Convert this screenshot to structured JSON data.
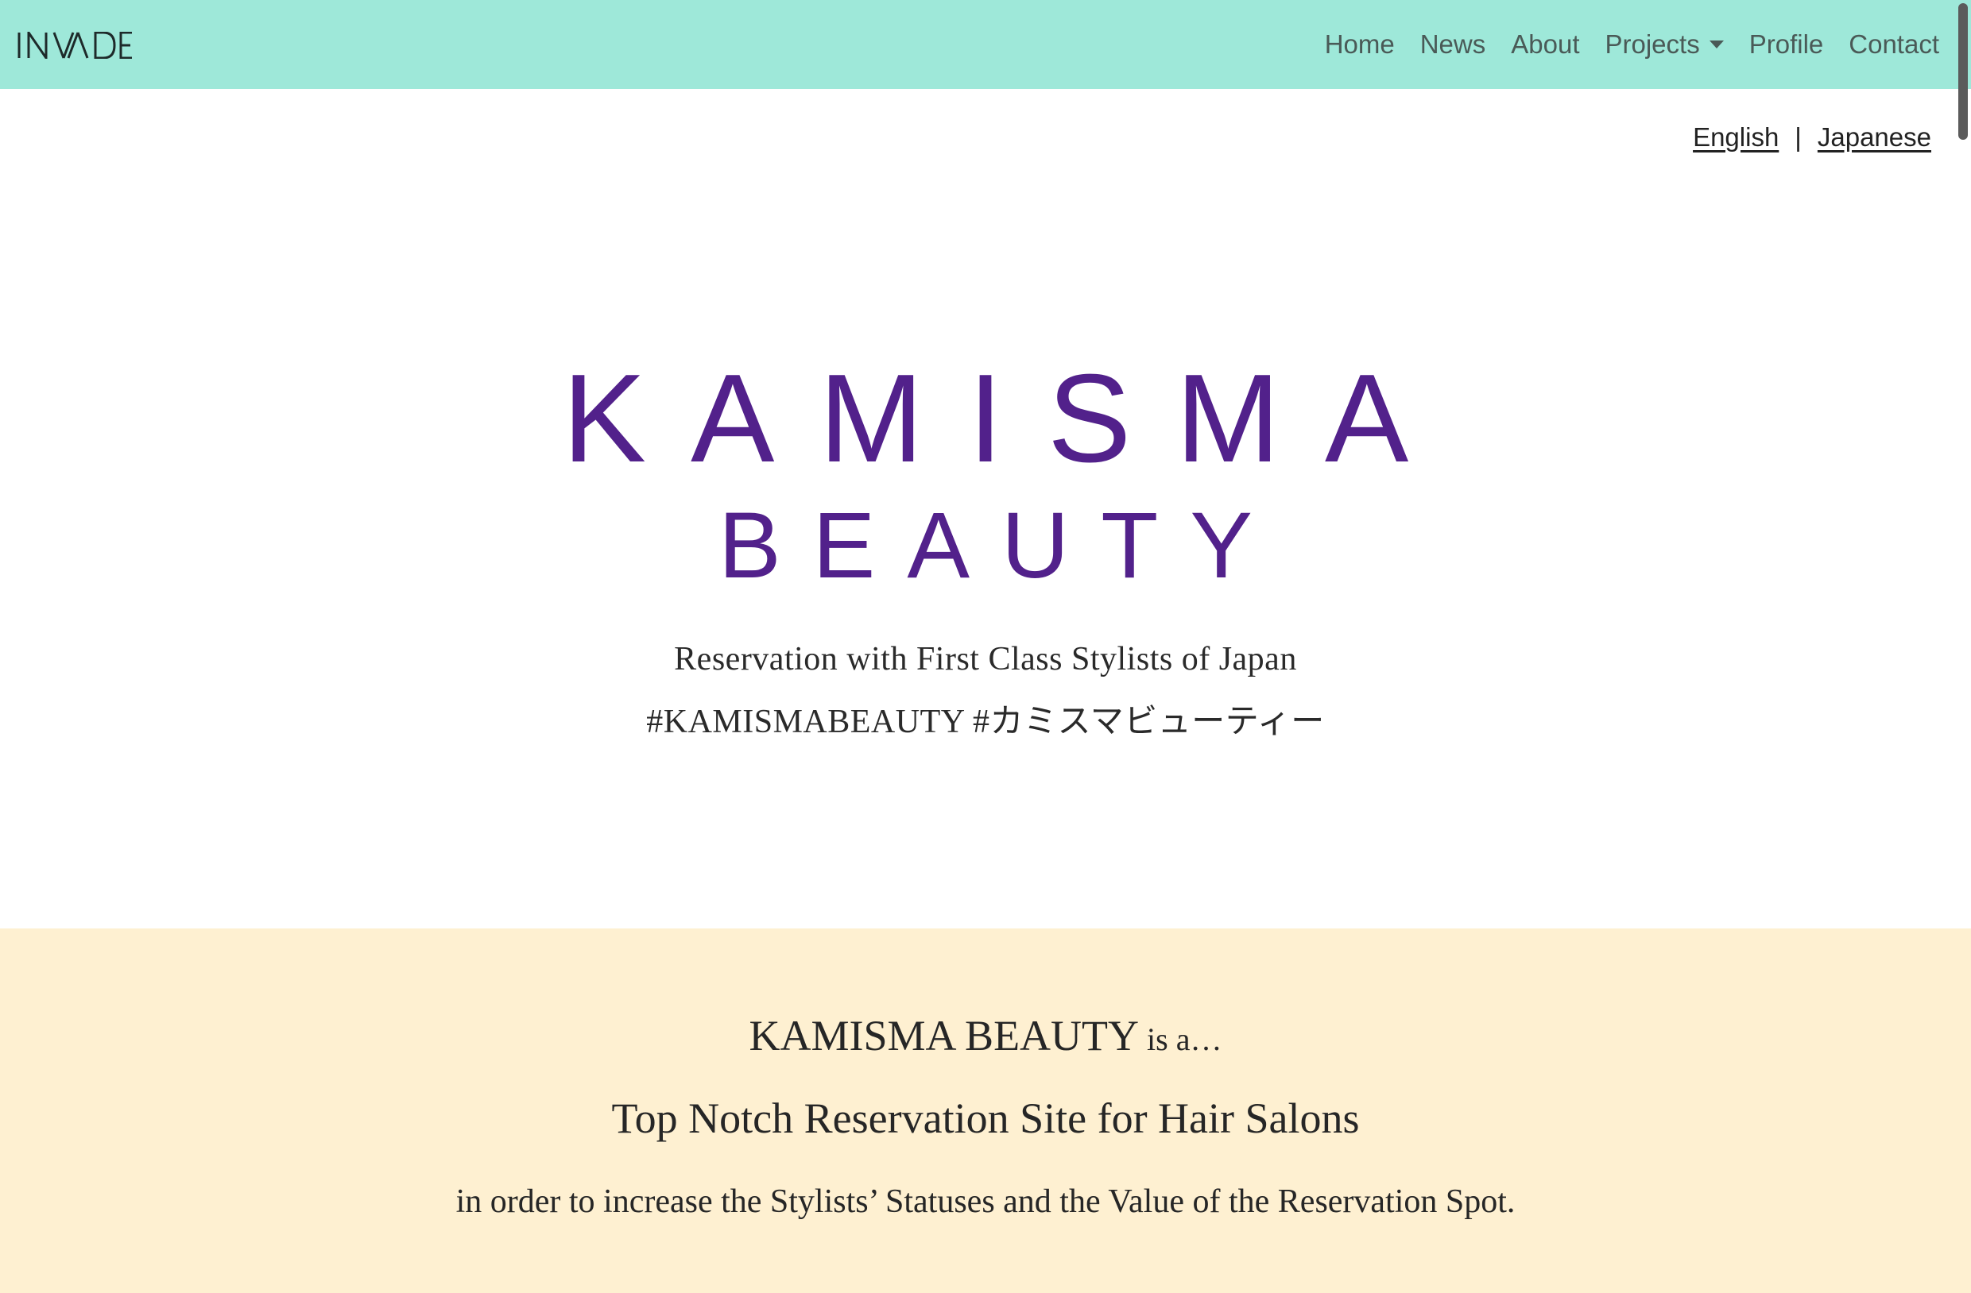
{
  "navbar": {
    "brand": "INVADE",
    "links": [
      {
        "label": "Home"
      },
      {
        "label": "News"
      },
      {
        "label": "About"
      },
      {
        "label": "Projects",
        "has_dropdown": true
      },
      {
        "label": "Profile"
      },
      {
        "label": "Contact"
      }
    ],
    "background_color": "#9ee8d9"
  },
  "language_switcher": {
    "english": "English",
    "separator": "|",
    "japanese": "Japanese"
  },
  "hero": {
    "logo_line1": "KAMISMA",
    "logo_line2": "BEAUTY",
    "logo_color": "#52218b",
    "tagline_1": "Reservation with First Class Stylists of Japan",
    "tagline_2": "#KAMISMABEAUTY #カミスマビューティー"
  },
  "about": {
    "heading_main": "KAMISMA BEAUTY",
    "heading_suffix": " is a…",
    "subheading": "Top Notch Reservation Site for Hair Salons",
    "text": "in order to increase the Stylists’ Statuses and the Value of the Reservation Spot.",
    "background_color": "#fef0d1"
  }
}
